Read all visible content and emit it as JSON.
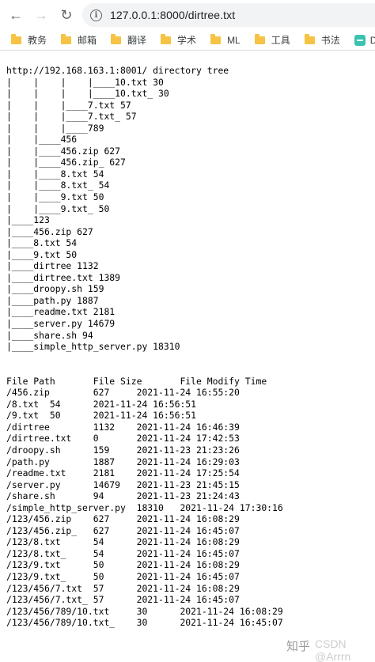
{
  "browser": {
    "url": "127.0.0.1:8000/dirtree.txt",
    "back_icon": "←",
    "forward_icon": "→",
    "reload_icon": "↻",
    "info_icon": "i"
  },
  "bookmarks": {
    "items": [
      "教务",
      "邮箱",
      "翻译",
      "学术",
      "ML",
      "工具",
      "书法"
    ],
    "trailing": "D"
  },
  "tree": {
    "lines": [
      "http://192.168.163.1:8001/ directory tree",
      "|    |    |    |____10.txt 30",
      "|    |    |    |____10.txt_ 30",
      "|    |    |____7.txt 57",
      "|    |    |____7.txt_ 57",
      "|    |    |____789",
      "|    |____456",
      "|    |____456.zip 627",
      "|    |____456.zip_ 627",
      "|    |____8.txt 54",
      "|    |____8.txt_ 54",
      "|    |____9.txt 50",
      "|    |____9.txt_ 50",
      "|____123",
      "|____456.zip 627",
      "|____8.txt 54",
      "|____9.txt 50",
      "|____dirtree 1132",
      "|____dirtree.txt 1389",
      "|____droopy.sh 159",
      "|____path.py 1887",
      "|____readme.txt 2181",
      "|____server.py 14679",
      "|____share.sh 94",
      "|____simple_http_server.py 18310"
    ]
  },
  "table": {
    "header": "File Path       File Size       File Modify Time",
    "rows": [
      "/456.zip        627     2021-11-24 16:55:20",
      "/8.txt  54      2021-11-24 16:56:51",
      "/9.txt  50      2021-11-24 16:56:51",
      "/dirtree        1132    2021-11-24 16:46:39",
      "/dirtree.txt    0       2021-11-24 17:42:53",
      "/droopy.sh      159     2021-11-23 21:23:26",
      "/path.py        1887    2021-11-24 16:29:03",
      "/readme.txt     2181    2021-11-24 17:25:54",
      "/server.py      14679   2021-11-23 21:45:15",
      "/share.sh       94      2021-11-23 21:24:43",
      "/simple_http_server.py  18310   2021-11-24 17:30:16",
      "/123/456.zip    627     2021-11-24 16:08:29",
      "/123/456.zip_   627     2021-11-24 16:45:07",
      "/123/8.txt      54      2021-11-24 16:08:29",
      "/123/8.txt_     54      2021-11-24 16:45:07",
      "/123/9.txt      50      2021-11-24 16:08:29",
      "/123/9.txt_     50      2021-11-24 16:45:07",
      "/123/456/7.txt  57      2021-11-24 16:08:29",
      "/123/456/7.txt_ 57      2021-11-24 16:45:07",
      "/123/456/789/10.txt     30      2021-11-24 16:08:29",
      "/123/456/789/10.txt_    30      2021-11-24 16:45:07"
    ]
  },
  "watermark": {
    "left": "知乎",
    "right": "CSDN @Arrrn"
  }
}
